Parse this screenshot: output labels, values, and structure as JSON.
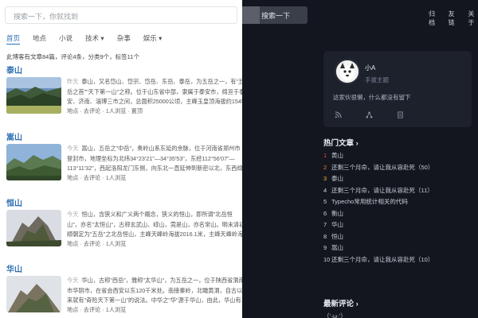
{
  "search": {
    "placeholder": "搜索一下，你就找到",
    "button": "搜索一下"
  },
  "top_links": [
    "归档",
    "友链",
    "关于"
  ],
  "nav": [
    {
      "label": "首页",
      "active": true
    },
    {
      "label": "地点",
      "active": false
    },
    {
      "label": "小说",
      "active": false
    },
    {
      "label": "技术 ▾",
      "active": false
    },
    {
      "label": "杂事",
      "active": false
    },
    {
      "label": "娱乐 ▾",
      "active": false
    }
  ],
  "stats": "此博客有文章84篇，评论4条，分类9个，标签11个",
  "articles": [
    {
      "title": "泰山",
      "when": "昨天",
      "excerpt": "泰山，又名岱山、岱宗、岱岳、东岳、泰岳，为五岳之一，有\"五岳之首\"\"天下第一山\"之称。位于山东省中部，隶属于泰安市，绵亘于泰安、济南、淄博三市之间，总面积25000公顷，主峰玉皇顶海拔约1545米。泰山相伴上下五千年的华夏文明传承历史，集国家兴盛。",
      "meta": "地点 · 去评论 · 1人浏览 · 置顶"
    },
    {
      "title": "嵩山",
      "when": "今天",
      "excerpt": "嵩山，五岳之\"中岳\"，奏岭山系东延的余脉，位于河南省郑州市登封市，地理坐标为北纬34°23'21\"—34°35'53\"，东经112°56'07\"—113°11'32\"，西起洛阳龙门东侧，向东北一直延伸到新密以北，东西绵亘近百千米，南北宽约20千米，嵩山由太室山和少室山组成。",
      "meta": "地点 · 去评论 · 1人浏览"
    },
    {
      "title": "恒山",
      "when": "今天",
      "excerpt": "恒山，含狭义和广义两个概念，狭义的恒山，即所谓\"北岳恒山\"，亦名\"太恒山\"，古称玄武山、崞山，莞是山，亦名常山。明末清初顺朝定为\"五岳\"之北岳恒山，主峰天峰岭海拔2016.1米，主峰天峰岭海拔2017米，号称\"人天北柱\"，\"绝塞名山\"，广义的恒山，或称恒山山脉。",
      "meta": "地点 · 去评论 · 1人浏览"
    },
    {
      "title": "华山",
      "when": "今天",
      "excerpt": "华山，古称\"西岳\"，雅称\"太华山\"，为五岳之一，位于陕西省渭南市华阴市，在省会西安以东120千米处。南接秦岭，北瞰黄渭，自古以来就有\"奇险天下第一山\"的说法。中华之\"华\"源于华山，由此，华山有了\"华夏之根\"之称。华山是中国道教主流全真派圣地，为\"。",
      "meta": "地点 · 去评论 · 1人浏览"
    }
  ],
  "profile": {
    "name": "小A",
    "subtitle": "手拔主题",
    "bio": "这家伙很懒，什么都没有留下",
    "icons": [
      "rss-icon",
      "share-icon",
      "document-icon"
    ]
  },
  "hot": {
    "title": "热门文章 ›",
    "items": [
      {
        "n": "1",
        "text": "黄山"
      },
      {
        "n": "2",
        "text": "还剩三个月命，请让我从容赴死（50）"
      },
      {
        "n": "3",
        "text": "泰山"
      },
      {
        "n": "4",
        "text": "还剩三个月命，请让我从容赴死（11）"
      },
      {
        "n": "5",
        "text": "Typecho常用统计相关的代码"
      },
      {
        "n": "6",
        "text": "衡山"
      },
      {
        "n": "7",
        "text": "华山"
      },
      {
        "n": "8",
        "text": "恒山"
      },
      {
        "n": "9",
        "text": "嵩山"
      },
      {
        "n": "10",
        "text": "还剩三个月命，请让我从容赴死（10）"
      }
    ]
  },
  "latest": {
    "title": "最新评论 ›",
    "first": "（'·ω·'）"
  },
  "colors": {
    "link": "#2f6fb0",
    "dark_bg": "#13161f",
    "card_bg": "#1c212c",
    "rank1": "#e5483b",
    "rank2": "#f0792a",
    "rank3": "#f2b330"
  }
}
